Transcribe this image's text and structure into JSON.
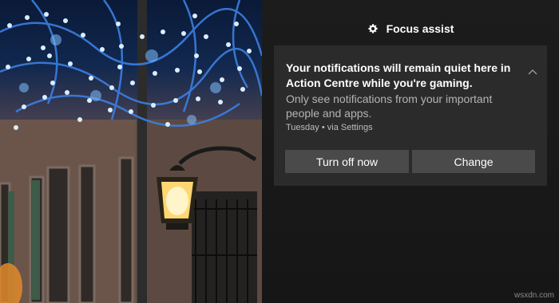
{
  "wallpaper": {
    "description_icon": "festive-lights-wallpaper",
    "colors": {
      "lights": "#5aa8ff",
      "lamp": "#ffd772"
    }
  },
  "header": {
    "icon": "gear-icon",
    "title": "Focus assist"
  },
  "notification": {
    "heading": "Your notifications will remain quiet here in Action Centre while you're gaming.",
    "body": "Only see notifications from your important people and apps.",
    "meta": "Tuesday • via Settings",
    "collapse_icon": "chevron-up-icon",
    "buttons": {
      "primary": "Turn off now",
      "secondary": "Change"
    }
  },
  "footer": {
    "watermark": "wsxdn.com"
  },
  "colors": {
    "panel_bg": "#1c1c1c",
    "card_bg": "#2b2b2b",
    "button_bg": "#4a4a4a",
    "heading_text": "#ffffff",
    "body_text": "#b4b4b4"
  }
}
